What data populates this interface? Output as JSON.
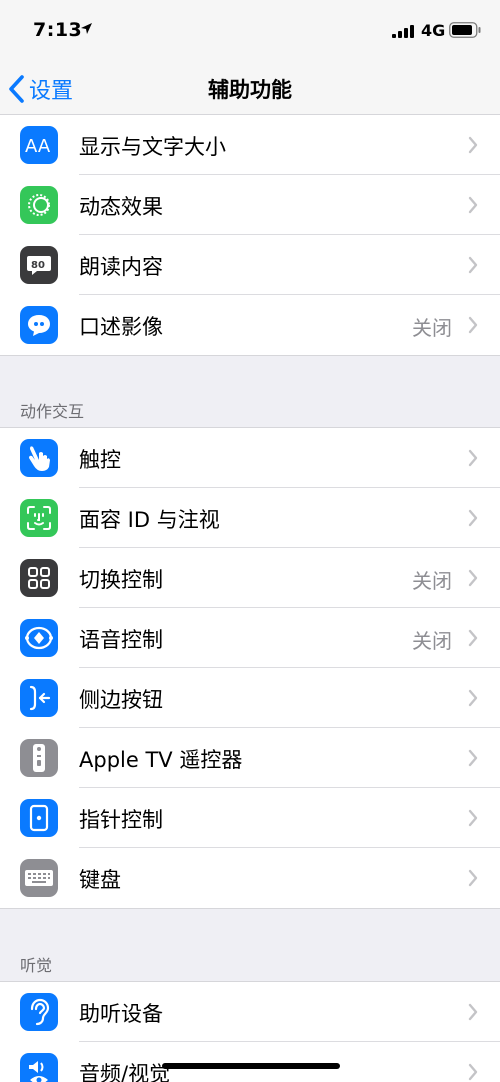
{
  "status_bar": {
    "time": "7:13",
    "network": "4G"
  },
  "nav": {
    "back_label": "设置",
    "title": "辅助功能"
  },
  "group1": [
    {
      "label": "显示与文字大小",
      "value": "",
      "icon": "text-size-icon",
      "color": "#0a7aff"
    },
    {
      "label": "动态效果",
      "value": "",
      "icon": "motion-icon",
      "color": "#34c759"
    },
    {
      "label": "朗读内容",
      "value": "",
      "icon": "spoken-content-icon",
      "color": "#3a3a3c"
    },
    {
      "label": "口述影像",
      "value": "关闭",
      "icon": "audio-description-icon",
      "color": "#0a7aff"
    }
  ],
  "section_interaction": "动作交互",
  "group2": [
    {
      "label": "触控",
      "value": "",
      "icon": "touch-icon",
      "color": "#0a7aff"
    },
    {
      "label": "面容 ID 与注视",
      "value": "",
      "icon": "face-id-icon",
      "color": "#34c759"
    },
    {
      "label": "切换控制",
      "value": "关闭",
      "icon": "switch-control-icon",
      "color": "#3a3a3c"
    },
    {
      "label": "语音控制",
      "value": "关闭",
      "icon": "voice-control-icon",
      "color": "#0a7aff"
    },
    {
      "label": "侧边按钮",
      "value": "",
      "icon": "side-button-icon",
      "color": "#0a7aff"
    },
    {
      "label": "Apple TV 遥控器",
      "value": "",
      "icon": "apple-tv-remote-icon",
      "color": "#8e8e93"
    },
    {
      "label": "指针控制",
      "value": "",
      "icon": "pointer-control-icon",
      "color": "#0a7aff"
    },
    {
      "label": "键盘",
      "value": "",
      "icon": "keyboard-icon",
      "color": "#8e8e93"
    }
  ],
  "section_hearing": "听觉",
  "group3": [
    {
      "label": "助听设备",
      "value": "",
      "icon": "hearing-device-icon",
      "color": "#0a7aff"
    },
    {
      "label": "音频/视觉",
      "value": "",
      "icon": "audio-visual-icon",
      "color": "#0a7aff"
    }
  ]
}
